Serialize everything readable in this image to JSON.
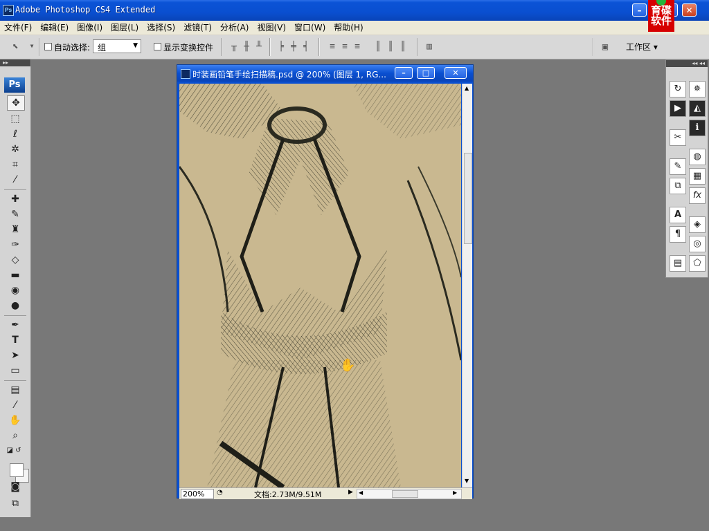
{
  "app": {
    "title": "Adobe Photoshop CS4 Extended",
    "badge": "Ps",
    "minimize": "–",
    "maximize": "□",
    "close": "✕"
  },
  "watermark": {
    "line1": "育碟",
    "line2": "软件"
  },
  "menu": [
    "文件(F)",
    "编辑(E)",
    "图像(I)",
    "图层(L)",
    "选择(S)",
    "滤镜(T)",
    "分析(A)",
    "视图(V)",
    "窗口(W)",
    "帮助(H)"
  ],
  "options": {
    "auto_select_label": "自动选择:",
    "auto_select_value": "组",
    "show_transform_label": "显示变换控件",
    "workspace_label": "工作区 ▾"
  },
  "toolbox": {
    "logo": "Ps",
    "tools": [
      "move-tool",
      "marquee-tool",
      "lasso-tool",
      "magic-wand-tool",
      "crop-tool",
      "eyedropper-tool",
      "healing-brush-tool",
      "brush-tool",
      "clone-stamp-tool",
      "history-brush-tool",
      "eraser-tool",
      "gradient-tool",
      "blur-tool",
      "dodge-tool",
      "pen-tool",
      "type-tool",
      "path-selection-tool",
      "shape-tool",
      "notes-tool",
      "eyedropper-3d-tool",
      "hand-tool",
      "zoom-tool"
    ]
  },
  "document": {
    "title": "时装画铅笔手绘扫描稿.psd @ 200% (图层 1, RG...",
    "zoom": "200%",
    "doc_size": "文档:2.73M/9.51M",
    "canvas_color": "#c9b890"
  }
}
